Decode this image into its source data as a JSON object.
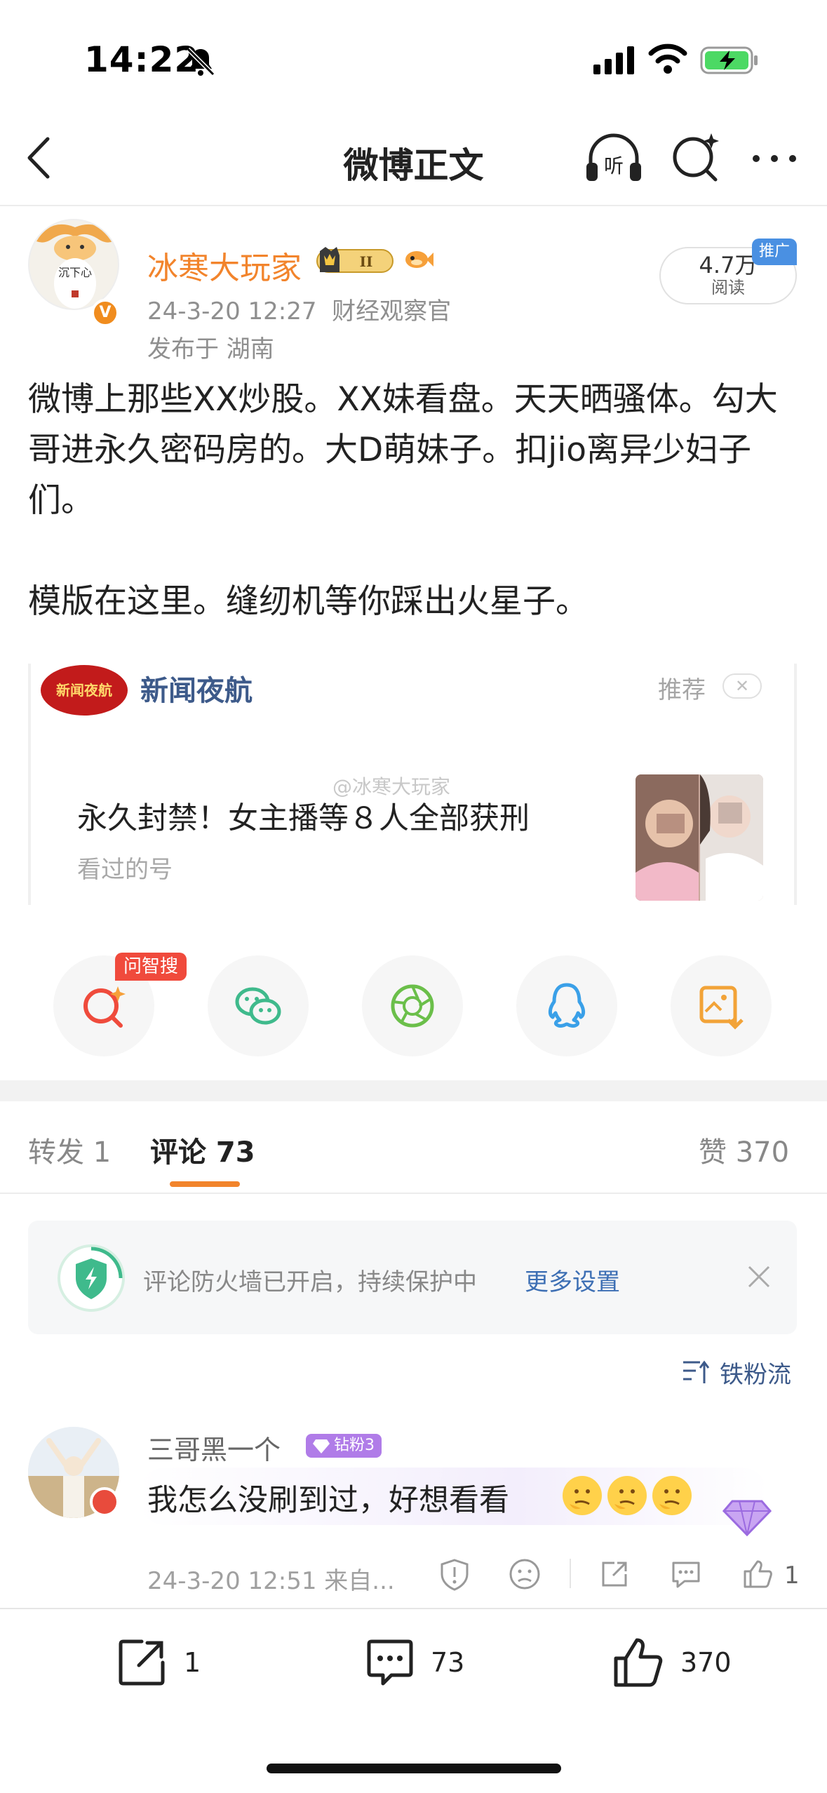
{
  "status_bar": {
    "time": "14:22"
  },
  "nav": {
    "title": "微博正文",
    "listen_label": "听"
  },
  "post": {
    "author": "冰寒大玩家",
    "member_level": "II",
    "avatar_text": "沉下心",
    "timestamp": "24-3-20 12:27",
    "source": "财经观察官",
    "location": "发布于 湖南",
    "reads": "4.7万",
    "reads_label": "阅读",
    "promo_tag": "推广",
    "body_line1": "微博上那些XX炒股。XX妹看盘。天天晒骚体。勾大哥进永久密码房的。大D萌妹子。扣jio离异少妇子们。",
    "body_line2": "模版在这里。缝纫机等你踩出火星子。"
  },
  "card": {
    "logo_text": "新闻夜航",
    "name": "新闻夜航",
    "recommend_label": "推荐",
    "watermark": "@冰寒大玩家",
    "headline": "永久封禁！女主播等８人全部获刑",
    "subtitle": "看过的号"
  },
  "share": {
    "ask_tag": "问智搜"
  },
  "tabs": {
    "repost": "转发 1",
    "comments": "评论 73",
    "likes": "赞 370"
  },
  "firewall": {
    "text": "评论防火墙已开启，持续保护中",
    "link": "更多设置"
  },
  "sort": {
    "label": "铁粉流"
  },
  "comment": {
    "name": "三哥黑一个",
    "fan_badge": "钻粉3",
    "text": "我怎么没刷到过，好想看看",
    "meta": "24-3-20 12:51 来自...",
    "likes": "1"
  },
  "bottom_bar": {
    "repost_count": "1",
    "comment_count": "73",
    "like_count": "370"
  },
  "colors": {
    "accent": "#f2842c",
    "link": "#3d6fb4",
    "name_blue": "#3d5a8a",
    "fan_purple": "#b07ce8"
  }
}
